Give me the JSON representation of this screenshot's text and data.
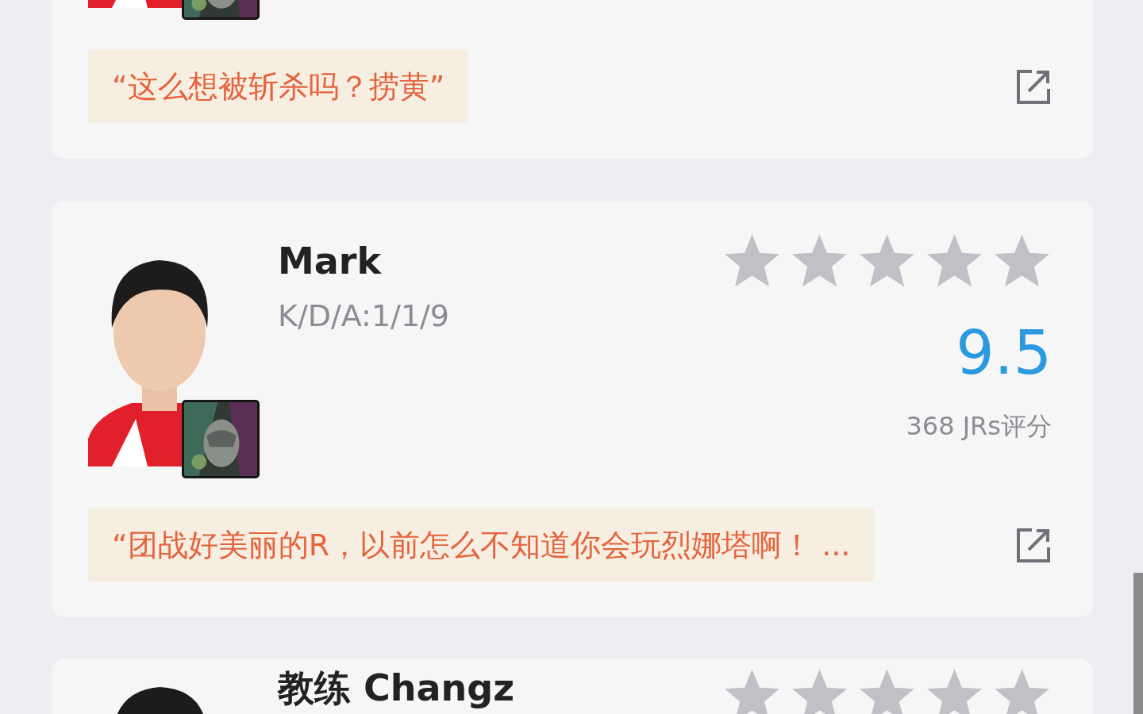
{
  "cards": [
    {
      "comment": "“这么想被斩杀吗？捞黄”"
    },
    {
      "name": "Mark",
      "kda": "K/D/A:1/1/9",
      "stars": 0,
      "score": "9.5",
      "raters": "368 JRs评分",
      "comment": "“团战好美丽的R，以前怎么不知道你会玩烈娜塔啊！ ..."
    },
    {
      "name": "教练 Changz",
      "stars": 0
    }
  ]
}
